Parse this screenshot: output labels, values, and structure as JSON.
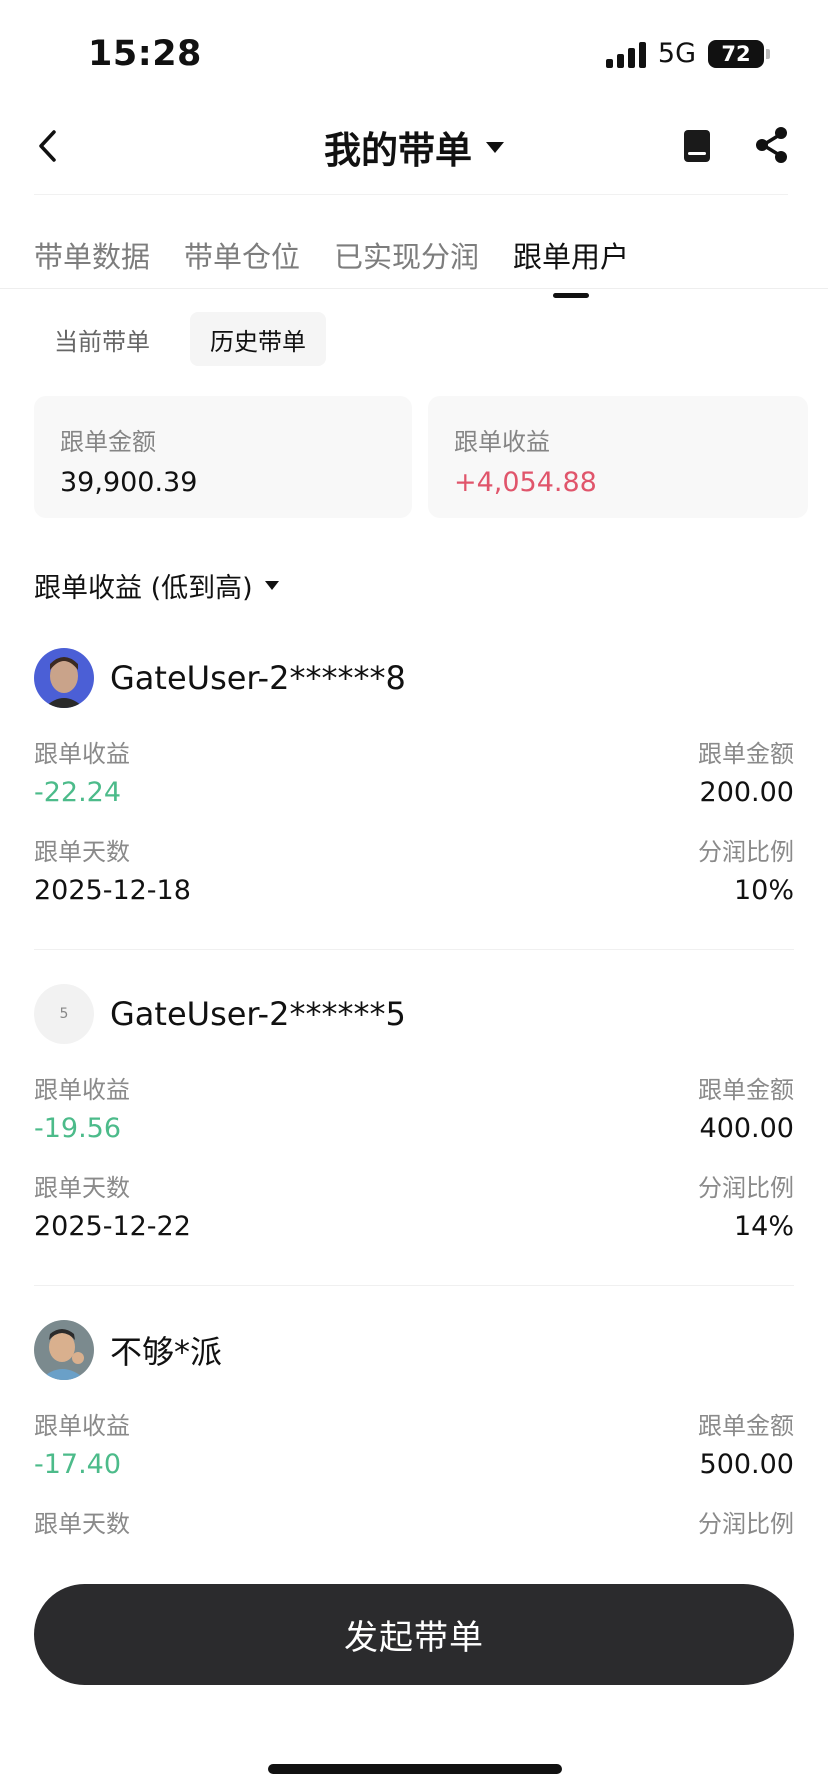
{
  "status_bar": {
    "time": "15:28",
    "network": "5G",
    "battery": "72"
  },
  "nav": {
    "title": "我的带单"
  },
  "tabs": [
    {
      "label": "带单数据",
      "active": false
    },
    {
      "label": "带单仓位",
      "active": false
    },
    {
      "label": "已实现分润",
      "active": false
    },
    {
      "label": "跟单用户",
      "active": true
    }
  ],
  "subtabs": [
    {
      "label": "当前带单",
      "active": false
    },
    {
      "label": "历史带单",
      "active": true
    }
  ],
  "summary": {
    "amount_label": "跟单金额",
    "amount_value": "39,900.39",
    "profit_label": "跟单收益",
    "profit_value": "+4,054.88"
  },
  "sort": {
    "label": "跟单收益 (低到高)"
  },
  "users": [
    {
      "name": "GateUser-2******8",
      "avatar": "photo",
      "profit_label": "跟单收益",
      "profit": "-22.24",
      "amount_label": "跟单金额",
      "amount": "200.00",
      "days_label": "跟单天数",
      "days": "2025-12-18",
      "ratio_label": "分润比例",
      "ratio": "10%"
    },
    {
      "name": "GateUser-2******5",
      "avatar_letter": "5",
      "profit_label": "跟单收益",
      "profit": "-19.56",
      "amount_label": "跟单金额",
      "amount": "400.00",
      "days_label": "跟单天数",
      "days": "2025-12-22",
      "ratio_label": "分润比例",
      "ratio": "14%"
    },
    {
      "name": "不够*派",
      "avatar": "photo",
      "profit_label": "跟单收益",
      "profit": "-17.40",
      "amount_label": "跟单金额",
      "amount": "500.00",
      "days_label": "跟单天数",
      "ratio_label": "分润比例"
    }
  ],
  "cta": {
    "label": "发起带单"
  },
  "colors": {
    "positive": "#e0556b",
    "negative": "#4cbb8a",
    "button": "#2b2b2d"
  }
}
